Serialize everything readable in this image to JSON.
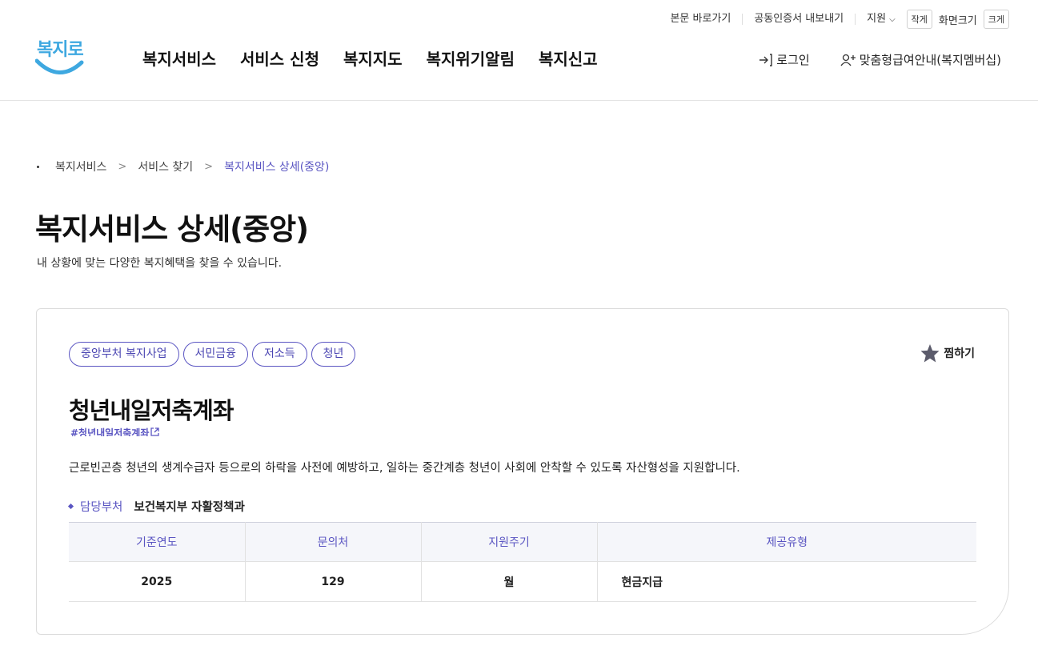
{
  "utility": {
    "skip_to_content": "본문 바로가기",
    "cert_export": "공동인증서 내보내기",
    "support": "지원",
    "font_smaller": "작게",
    "font_size_label": "화면크기",
    "font_larger": "크게"
  },
  "logo": {
    "text": "복지로"
  },
  "gnb": {
    "items": [
      "복지서비스",
      "서비스 신청",
      "복지지도",
      "복지위기알림",
      "복지신고"
    ]
  },
  "header_right": {
    "login": "로그인",
    "membership": "맞춤형급여안내(복지멤버십)"
  },
  "breadcrumb": {
    "items": [
      "복지서비스",
      "서비스 찾기",
      "복지서비스 상세(중앙)"
    ]
  },
  "page": {
    "title": "복지서비스 상세(중앙)",
    "subtitle": "내 상황에 맞는 다양한 복지혜택을 찾을 수 있습니다."
  },
  "service": {
    "tags": [
      "중앙부처 복지사업",
      "서민금융",
      "저소득",
      "청년"
    ],
    "bookmark_label": "찜하기",
    "title": "청년내일저축계좌",
    "hashtag": "#청년내일저축계좌",
    "description": "근로빈곤층 청년의 생계수급자 등으로의 하락을 사전에 예방하고, 일하는 중간계층 청년이 사회에 안착할 수 있도록 자산형성을 지원합니다.",
    "dept_label": "담당부처",
    "dept_value": "보건복지부 자활정책과",
    "table": {
      "headers": [
        "기준연도",
        "문의처",
        "지원주기",
        "제공유형"
      ],
      "row": [
        "2025",
        "129",
        "월",
        "현금지급"
      ]
    }
  },
  "colors": {
    "accent": "#5a55c2",
    "logo_blue": "#3ea8e0",
    "table_header_bg": "#f5f6fa"
  }
}
